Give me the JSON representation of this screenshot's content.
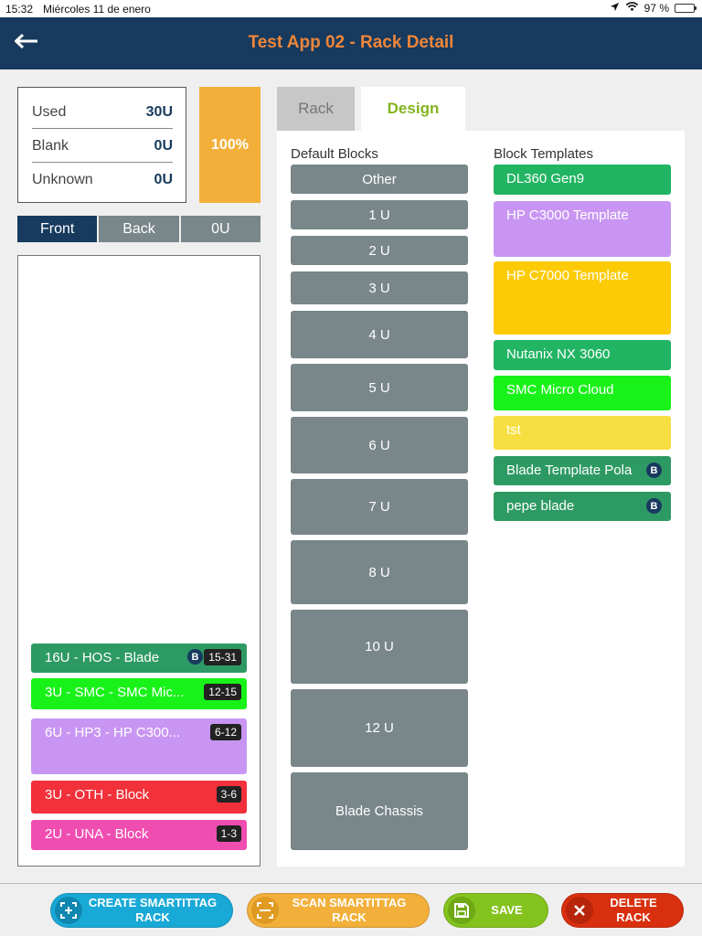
{
  "status_bar": {
    "time": "15:32",
    "date": "Miércoles 11 de enero",
    "battery": "97 %"
  },
  "header": {
    "title": "Test App 02 - Rack Detail"
  },
  "stats": [
    {
      "label": "Used",
      "value": "30U"
    },
    {
      "label": "Blank",
      "value": "0U"
    },
    {
      "label": "Unknown",
      "value": "0U"
    }
  ],
  "usage_percent": "100%",
  "view_tabs": [
    "Front",
    "Back",
    "0U"
  ],
  "rack_blocks": [
    {
      "label": "16U - HOS - Blade",
      "range": "15-31",
      "badge": "B",
      "color": "#2e9a63"
    },
    {
      "label": "3U - SMC - SMC Mic...",
      "range": "12-15",
      "color": "#19f219"
    },
    {
      "label": "6U - HP3 - HP C300...",
      "range": "6-12",
      "color": "#c896f2"
    },
    {
      "label": "3U - OTH - Block",
      "range": "3-6",
      "color": "#f2313b"
    },
    {
      "label": "2U - UNA - Block",
      "range": "1-3",
      "color": "#f04db1"
    }
  ],
  "panel_tabs": {
    "rack": "Rack",
    "design": "Design"
  },
  "default_blocks": {
    "heading": "Default Blocks",
    "items": [
      "Other",
      "1 U",
      "2 U",
      "3 U",
      "4 U",
      "5 U",
      "6 U",
      "7 U",
      "8 U",
      "10 U",
      "12 U",
      "Blade Chassis"
    ]
  },
  "block_templates": {
    "heading": "Block Templates",
    "items": [
      {
        "label": "DL360 Gen9",
        "color": "#21b463"
      },
      {
        "label": "HP C3000 Template",
        "color": "#c896f2"
      },
      {
        "label": "HP C7000 Template",
        "color": "#fccb05"
      },
      {
        "label": "Nutanix NX 3060",
        "color": "#21b463"
      },
      {
        "label": "SMC Micro Cloud",
        "color": "#19f219"
      },
      {
        "label": "tst",
        "color": "#f8df41"
      },
      {
        "label": "Blade Template Pola",
        "badge": "B",
        "color": "#2e9a63"
      },
      {
        "label": "pepe blade",
        "badge": "B",
        "color": "#2e9a63"
      }
    ]
  },
  "footer_buttons": {
    "create": "CREATE SMARTITTAG RACK",
    "scan": "SCAN SMARTITTAG RACK",
    "save": "SAVE",
    "delete": "DELETE RACK"
  },
  "icons": {
    "back": "arrow-left-icon",
    "create": "qr-add-icon",
    "scan": "scan-frame-icon",
    "save": "floppy-icon",
    "delete": "close-icon",
    "wifi": "wifi-icon",
    "location": "location-arrow-icon",
    "battery": "battery-icon"
  },
  "colors": {
    "header_bg": "#173a5e",
    "title": "#f0863a",
    "design_tab": "#84b41e",
    "default_block": "#79868a",
    "percent_bg": "#f2b03b",
    "create_btn": "#19a9d6",
    "scan_btn": "#f2b03b",
    "save_btn": "#84c21e",
    "delete_btn": "#d8300f"
  }
}
